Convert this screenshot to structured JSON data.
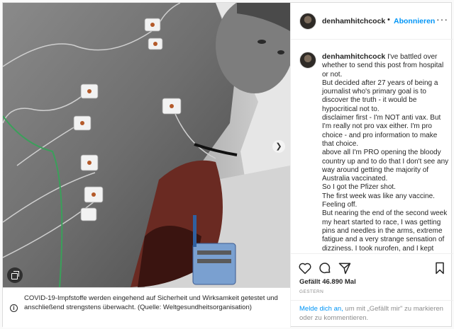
{
  "post": {
    "username": "denhamhitchcock",
    "follow_label": "Abonnieren",
    "separator": "•",
    "more_label": "···"
  },
  "caption": {
    "username": "denhamhitchcock",
    "lines": [
      "I've battled over whether to send this post from hospital or not.",
      "But decided after 27 years of being a journalist who's primary goal is to discover the truth - it would be hypocritical not to.",
      "disclaimer first - I'm NOT anti vax. But I'm really not pro vax either. I'm pro choice - and pro information to make that choice.",
      "above all I'm PRO opening the bloody country up and to do that I don't see any way around getting the majority of Australia vaccinated.",
      "So I got the Pfizer shot.",
      "The first week was like any vaccine. Feeling off.",
      "But nearing the end of the second week my heart started to race, I was getting pins and needles in the arms, extreme fatigue and a very strange sensation of dizziness. I took nurofen, and I kept working."
    ]
  },
  "stats": {
    "likes": "Gefällt 46.890 Mal",
    "date": "GESTERN"
  },
  "login_prompt": {
    "link": "Melde dich an,",
    "text": " um mit „Gefällt mir\" zu markieren oder zu kommentieren."
  },
  "notice": {
    "text": "COVID-19-Impfstoffe werden eingehend auf Sicherheit und Wirksamkeit getestet und anschließend strengstens überwacht. (Quelle: Weltgesundheitsorganisation)",
    "icon": "info-icon"
  },
  "icons": {
    "like": "heart-icon",
    "comment": "comment-icon",
    "share": "share-icon",
    "save": "bookmark-icon",
    "next": "chevron-right-icon",
    "carousel": "carousel-icon"
  },
  "colors": {
    "link_blue": "#0095f6",
    "text": "#262626",
    "muted": "#8e8e8e",
    "border": "#dbdbdb"
  }
}
